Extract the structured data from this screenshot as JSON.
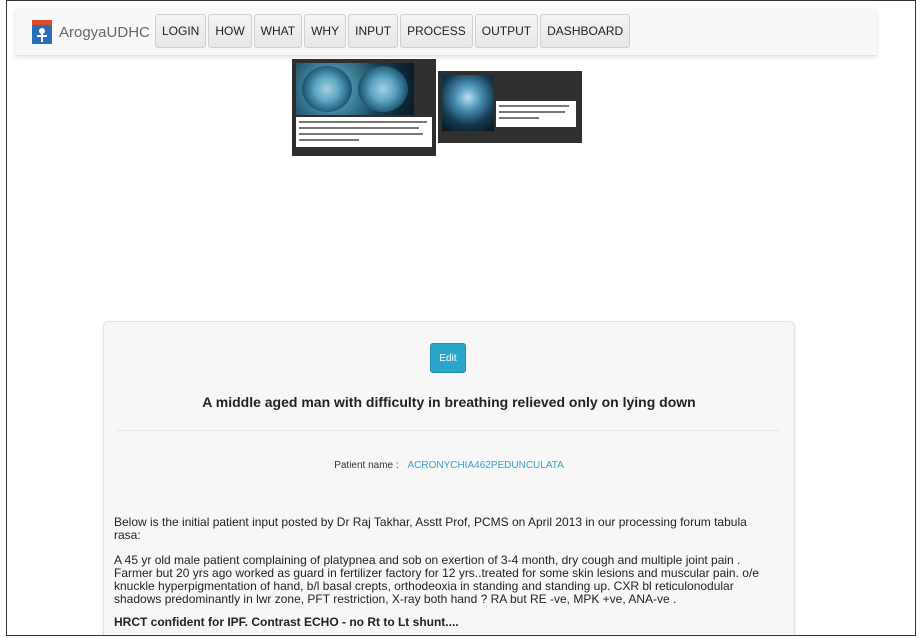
{
  "brand": {
    "name": "ArogyaUDHC",
    "logo_icon": "arogya-logo-icon"
  },
  "nav": {
    "items": [
      "LOGIN",
      "HOW",
      "WHAT",
      "WHY",
      "INPUT",
      "PROCESS",
      "OUTPUT",
      "DASHBOARD"
    ]
  },
  "card": {
    "edit_label": "Edit",
    "title": "A middle aged man with difficulty in breathing relieved only on lying down",
    "patient_label": "Patient name :",
    "patient_value": "ACRONYCHIA462PEDUNCULATA",
    "intro": "Below is the initial patient input posted by Dr Raj Takhar, Asstt Prof, PCMS on April 2013 in our processing forum tabula rasa:",
    "case_text": "A 45 yr old male patient complaining of platypnea and sob on exertion of 3-4 month, dry cough and multiple joint pain . Farmer but 20 yrs ago worked as guard in fertilizer factory for 12 yrs..treated for some skin lesions and muscular pain. o/e knuckle hyperpigmentation of hand, b/l basal crepts, orthodeoxia in standing and standing up. CXR bl reticulonodular shadows predominantly in lwr zone, PFT restriction, X-ray both hand ? RA but RE -ve, MPK +ve, ANA-ve .",
    "hrct_text": "HRCT confident for IPF. Contrast ECHO - no Rt to Lt shunt...."
  },
  "colors": {
    "accent": "#2ba6cb",
    "link": "#3a9ec6"
  }
}
